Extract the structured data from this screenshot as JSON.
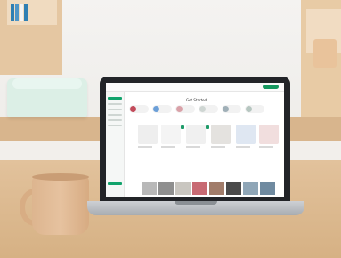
{
  "scene": {
    "description_tags": [
      "laptop",
      "craft-app",
      "mug",
      "cutting-machine"
    ],
    "app": {
      "title": "Get Started"
    },
    "colors": {
      "accent_green": "#15985f",
      "wood": "#e2c29c",
      "mug": "#e6c29f",
      "machine_mint": "#dcefe6"
    }
  }
}
